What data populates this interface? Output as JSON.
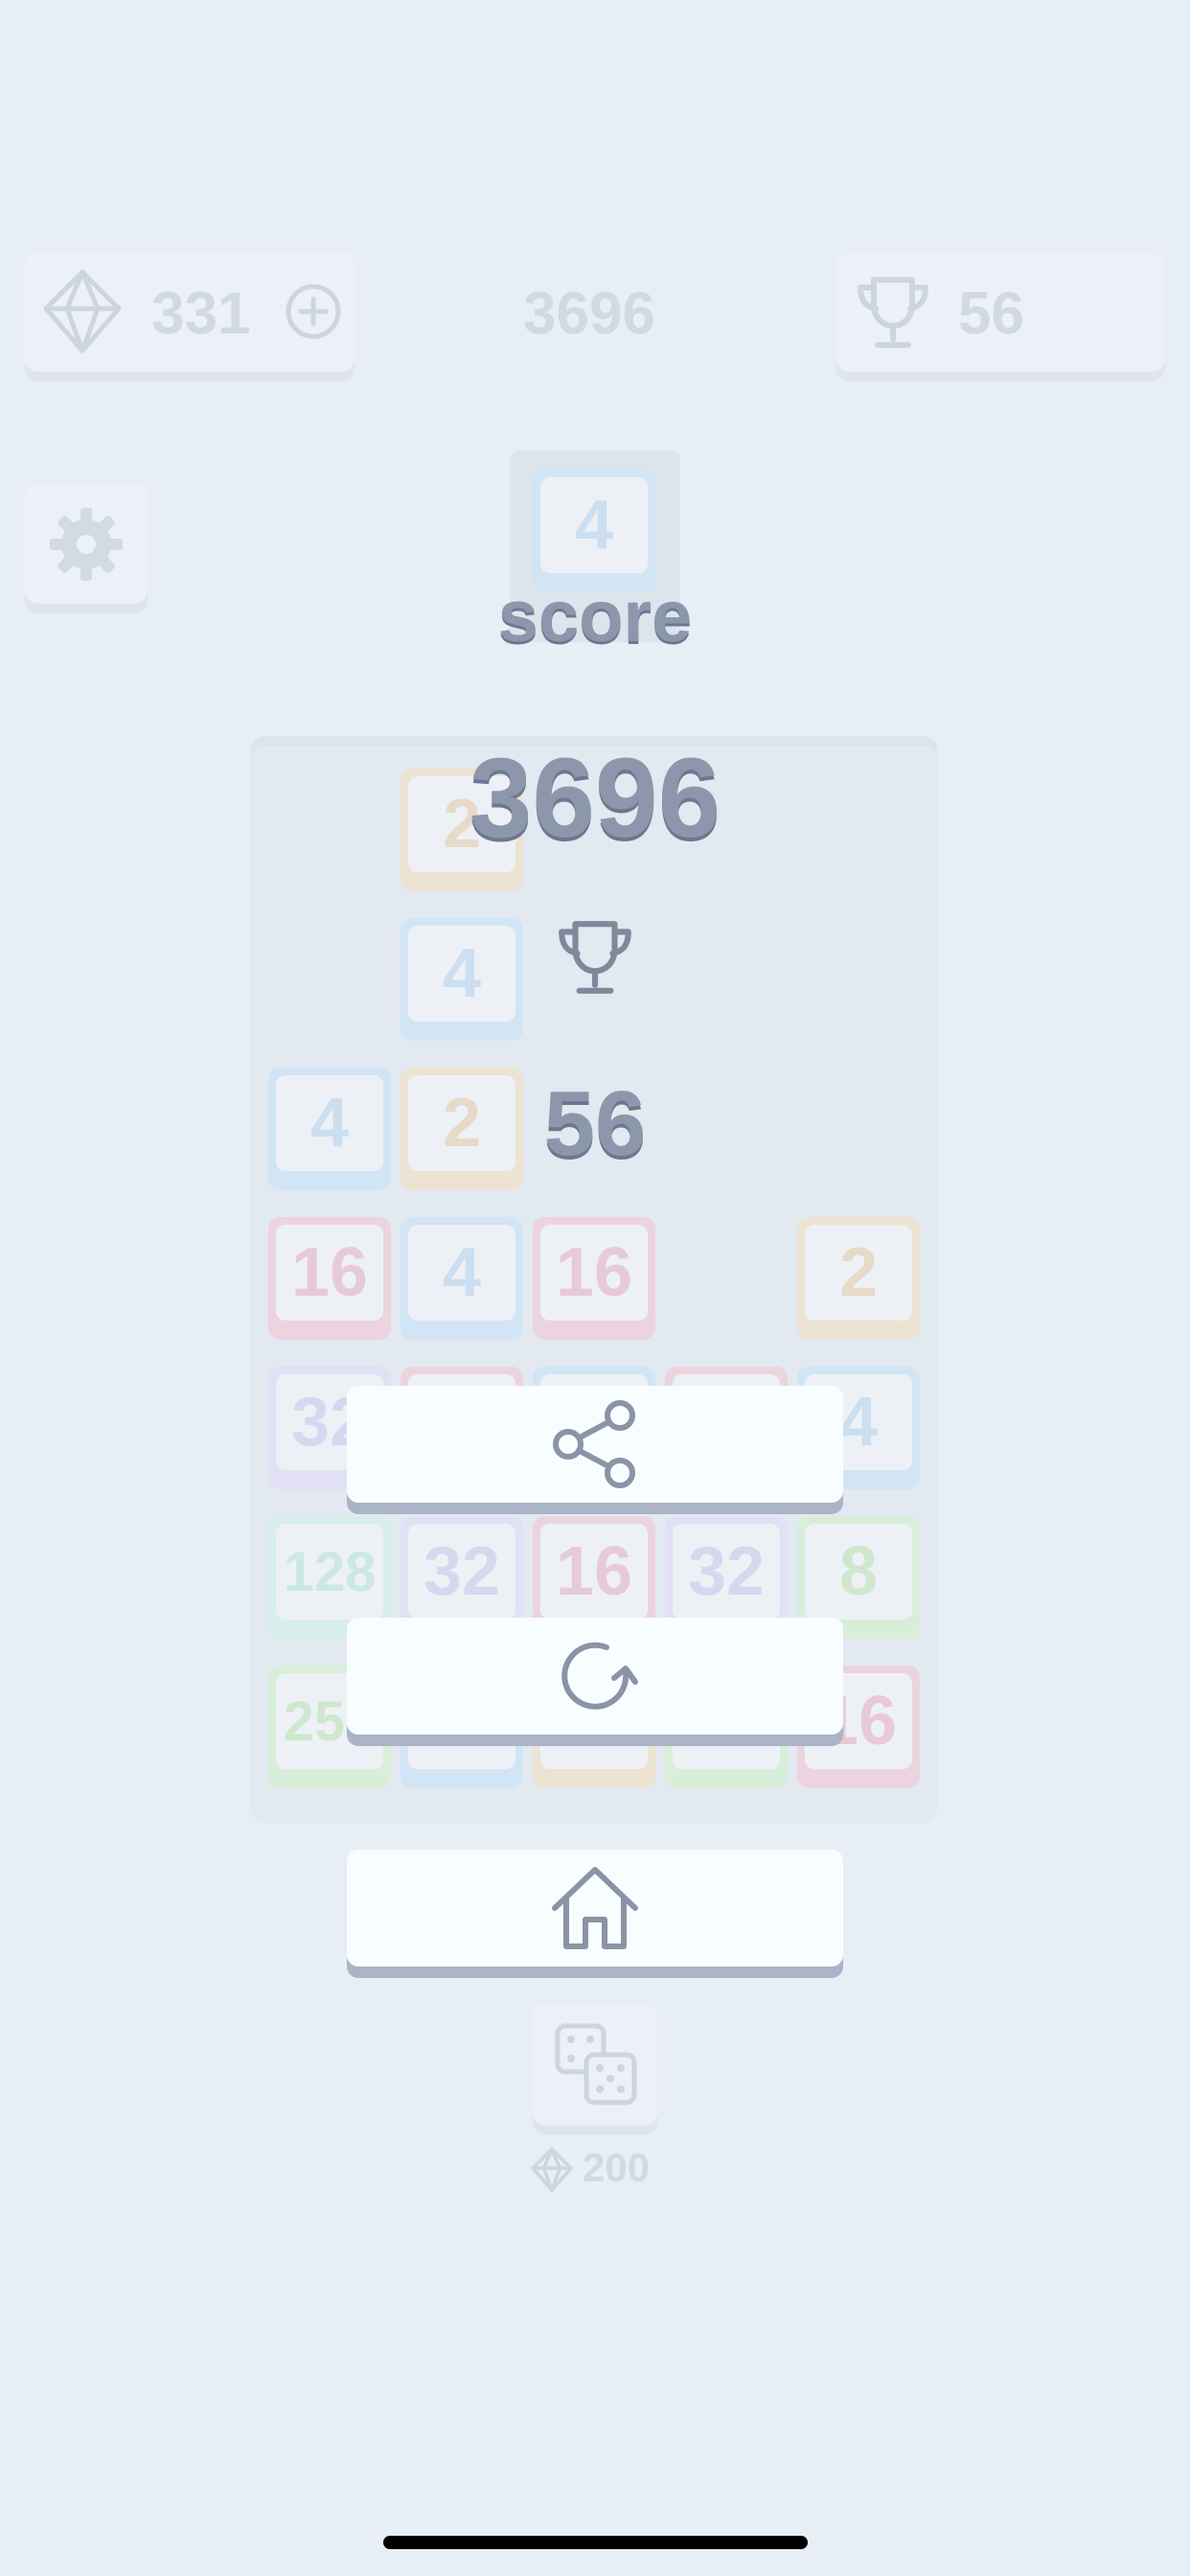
{
  "hud": {
    "gems": "331",
    "score": "3696",
    "best": "56"
  },
  "next_tile": "4",
  "board": {
    "tiles": [
      {
        "v": "2",
        "color": "orange",
        "col": 1,
        "row": 0
      },
      {
        "v": "4",
        "color": "blue",
        "col": 1,
        "row": 1
      },
      {
        "v": "4",
        "color": "blue",
        "col": 0,
        "row": 2
      },
      {
        "v": "2",
        "color": "orange",
        "col": 1,
        "row": 2
      },
      {
        "v": "16",
        "color": "pink",
        "col": 0,
        "row": 3
      },
      {
        "v": "4",
        "color": "blue",
        "col": 1,
        "row": 3
      },
      {
        "v": "16",
        "color": "pink",
        "col": 2,
        "row": 3
      },
      {
        "v": "2",
        "color": "orange",
        "col": 4,
        "row": 3
      },
      {
        "v": "32",
        "color": "purple",
        "col": 0,
        "row": 4
      },
      {
        "v": "",
        "color": "pink",
        "col": 1,
        "row": 4
      },
      {
        "v": "",
        "color": "blue",
        "col": 2,
        "row": 4
      },
      {
        "v": "",
        "color": "pink",
        "col": 3,
        "row": 4
      },
      {
        "v": "4",
        "color": "blue",
        "col": 4,
        "row": 4
      },
      {
        "v": "128",
        "color": "mint",
        "col": 0,
        "row": 5
      },
      {
        "v": "32",
        "color": "purple",
        "col": 1,
        "row": 5
      },
      {
        "v": "16",
        "color": "pink",
        "col": 2,
        "row": 5
      },
      {
        "v": "32",
        "color": "purple",
        "col": 3,
        "row": 5
      },
      {
        "v": "8",
        "color": "green",
        "col": 4,
        "row": 5
      },
      {
        "v": "256",
        "color": "green",
        "col": 0,
        "row": 6
      },
      {
        "v": "",
        "color": "blue",
        "col": 1,
        "row": 6
      },
      {
        "v": "",
        "color": "orange",
        "col": 2,
        "row": 6
      },
      {
        "v": "",
        "color": "green",
        "col": 3,
        "row": 6
      },
      {
        "v": "16",
        "color": "pink",
        "col": 4,
        "row": 6
      }
    ]
  },
  "dice_cost": "200",
  "overlay": {
    "score_label": "score",
    "score": "3696",
    "best": "56"
  },
  "icons": {
    "gem": "gem-icon",
    "add": "plus-circle-icon",
    "trophy": "trophy-icon",
    "settings": "gear-icon",
    "share": "share-icon",
    "restart": "restart-icon",
    "home": "home-icon",
    "dice": "dice-icon"
  }
}
